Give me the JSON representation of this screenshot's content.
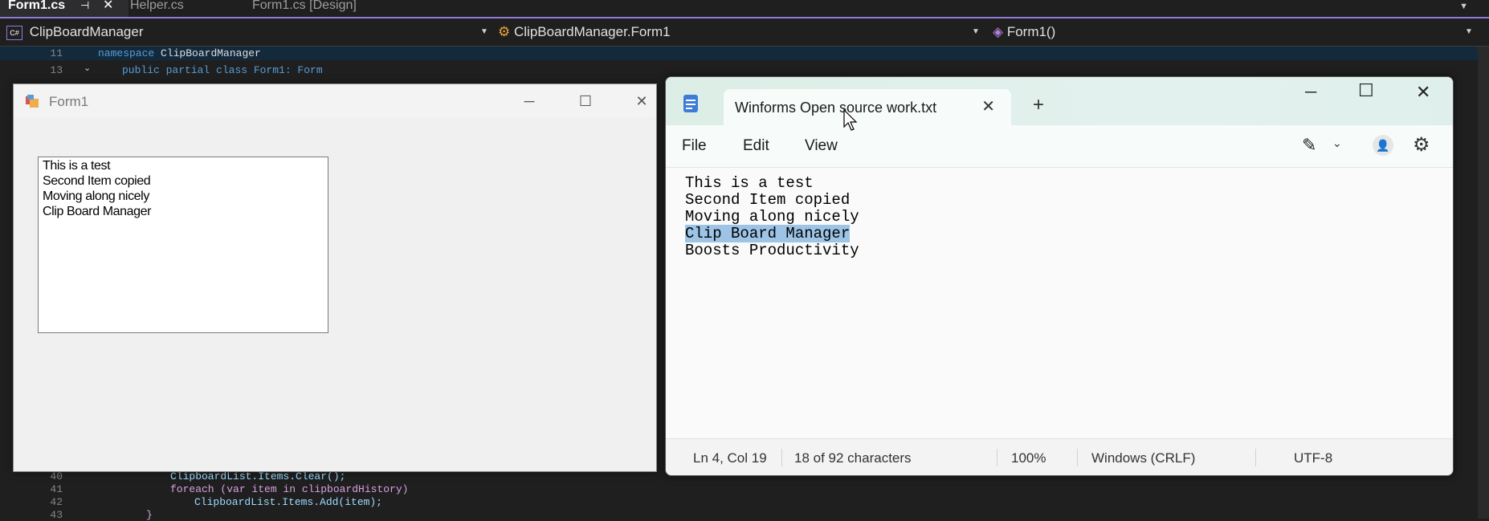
{
  "vs": {
    "tabs": [
      {
        "label": "Form1.cs",
        "active": true
      },
      {
        "label": "Helper.cs",
        "active": false
      },
      {
        "label": "Form1.cs [Design]",
        "active": false
      }
    ],
    "tab_icons": [
      "pin-icon",
      "close-icon"
    ],
    "nav": {
      "project": "ClipBoardManager",
      "class": "ClipBoardManager.Form1",
      "member": "Form1()"
    },
    "code_top": [
      {
        "ln": "11",
        "text": "namespace ClipBoardManager"
      },
      {
        "ln": "13",
        "text": "public partial class Form1: Form"
      }
    ],
    "code_bottom": [
      {
        "ln": "40",
        "text": "ClipboardList.Items.Clear();"
      },
      {
        "ln": "41",
        "text": "foreach (var item in clipboardHistory)"
      },
      {
        "ln": "42",
        "text": "ClipboardList.Items.Add(item);"
      },
      {
        "ln": "43",
        "text": "}"
      }
    ]
  },
  "form1": {
    "title": "Form1",
    "list_items": [
      "This is a test",
      "Second Item copied",
      "Moving along nicely",
      "Clip Board Manager"
    ]
  },
  "notepad": {
    "tab_title": "Winforms Open source work.txt",
    "menu": [
      "File",
      "Edit",
      "View"
    ],
    "lines": [
      "This is a test",
      "Second Item copied",
      "Moving along nicely",
      "Clip Board Manager",
      "Boosts Productivity"
    ],
    "selected_line_index": 3,
    "status": {
      "position": "Ln 4, Col 19",
      "selection": "18 of 92 characters",
      "zoom": "100%",
      "line_ending": "Windows (CRLF)",
      "encoding": "UTF-8"
    },
    "selection_color": "#9dc3e6"
  }
}
